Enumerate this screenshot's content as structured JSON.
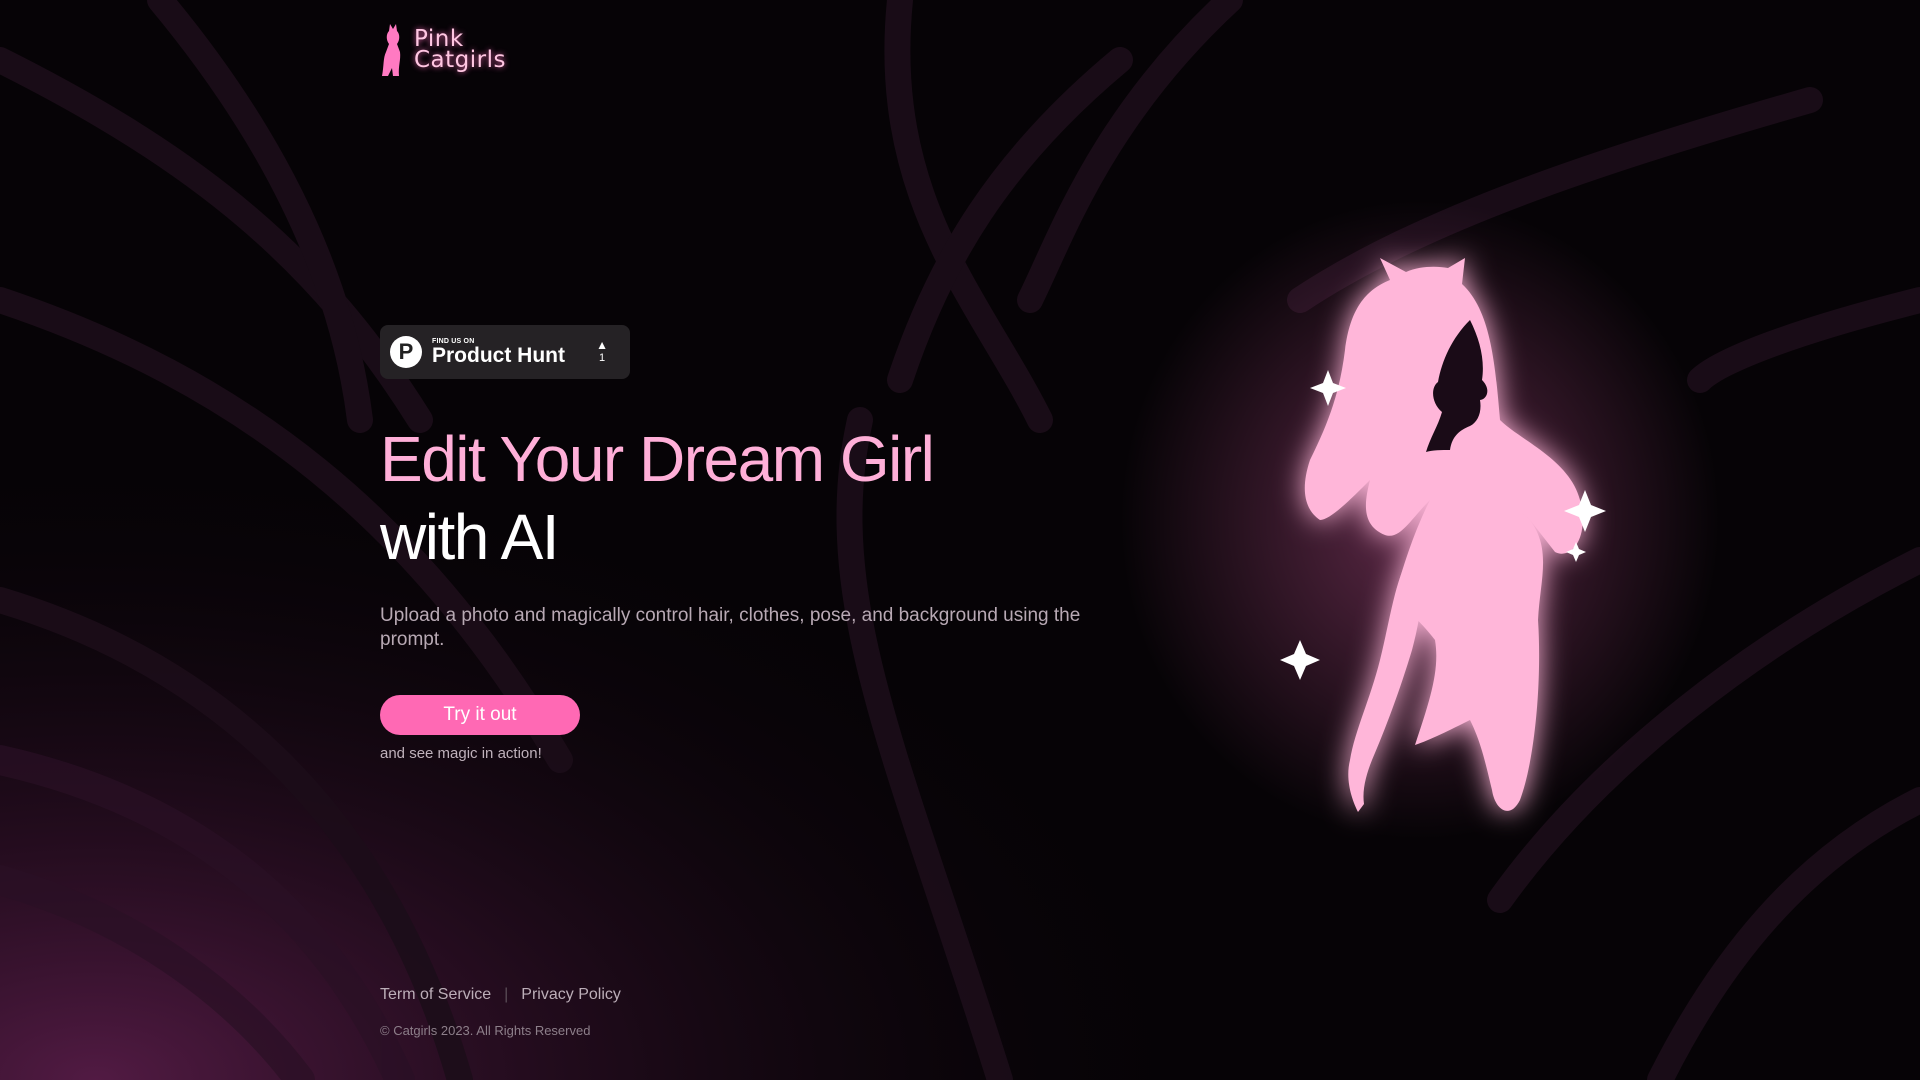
{
  "brand": {
    "line1": "Pink",
    "line2": "Catgirls",
    "icon": "catgirl-silhouette-icon"
  },
  "product_hunt": {
    "find_label": "FIND US ON",
    "name": "Product Hunt",
    "logo_letter": "P",
    "arrow": "▲",
    "votes": "1"
  },
  "hero": {
    "headline_line1": "Edit Your Dream Girl",
    "headline_line2": "with AI",
    "subtitle": "Upload a photo and magically control hair, clothes, pose, and background using the prompt.",
    "cta_label": "Try it out",
    "cta_note": "and see magic in action!",
    "illustration_icon": "catgirl-silhouette-illustration"
  },
  "footer": {
    "links": [
      "Term of Service",
      "Privacy Policy"
    ],
    "separator": "|",
    "copyright": "© Catgirls 2023. All Rights Reserved"
  },
  "colors": {
    "accent": "#ff69b4",
    "headline_pink": "#ffafd8",
    "background": "#060306",
    "silhouette": "#ffb6d9"
  }
}
